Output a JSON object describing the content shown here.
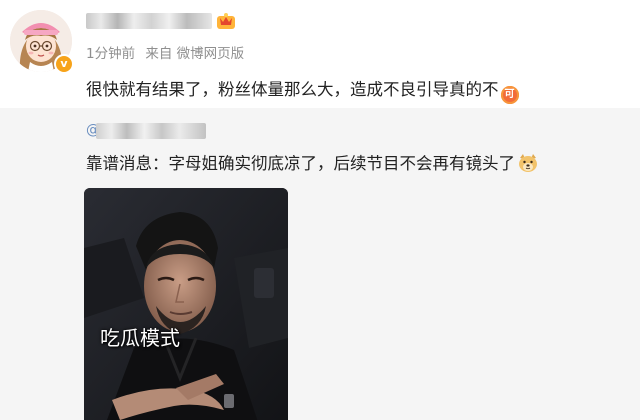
{
  "post": {
    "author": {
      "avatar_icon": "cartoon-girl-avatar",
      "verified_badge": "v",
      "vip_icon": "vip-crown-icon"
    },
    "meta": {
      "time": "1分钟前",
      "source": "来自 微博网页版"
    },
    "text": "很快就有结果了，粉丝体量那么大，造成不良引导真的不",
    "text_emoji": {
      "icon": "ke-emoji",
      "label": "可"
    }
  },
  "repost": {
    "at_symbol": "@",
    "text": "靠谱消息：字母姐确实彻底凉了，后续节目不会再有镜头了",
    "text_emoji": "doge-emoji",
    "media": {
      "caption": "吃瓜模式"
    }
  },
  "colors": {
    "repost_bg": "#f5f5f5",
    "meta_text": "#8f8f8f",
    "badge": "#f7a31a",
    "ke_emoji": "#f26b3a"
  }
}
